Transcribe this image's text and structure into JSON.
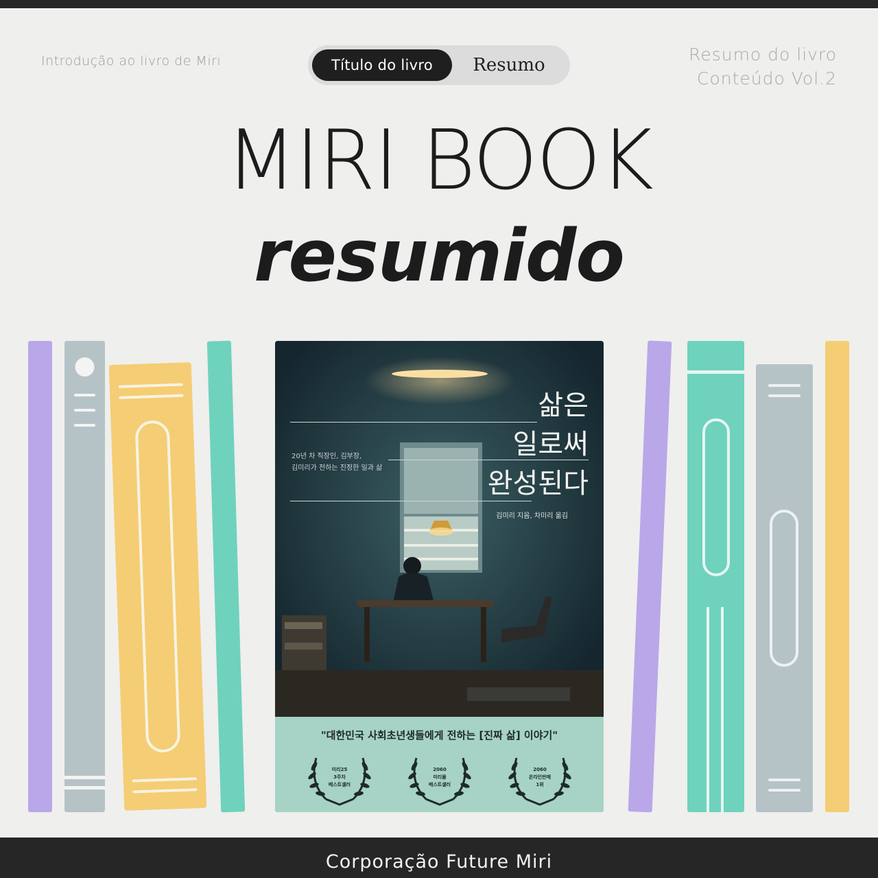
{
  "header": {
    "intro": "Introdução ao livro de Miri",
    "tabs": [
      {
        "label": "Título do livro",
        "active": true
      },
      {
        "label": "Resumo",
        "active": false
      }
    ],
    "volume_line1": "Resumo do livro",
    "volume_line2": "Conteúdo Vol.2"
  },
  "hero": {
    "title": "MIRI BOOK",
    "subtitle": "resumido"
  },
  "book": {
    "title_line1": "삶은",
    "title_line2": "일로써",
    "title_line3": "완성된다",
    "subtitle_line1": "20년 차 직장인, 김부장,",
    "subtitle_line2": "김미리가 전하는 진정한 일과 삶",
    "author": "김미리 지음, 차미리 옮김",
    "quote": "\"대한민국 사회초년생들에게 전하는 [진짜 삶] 이야기\"",
    "awards": [
      {
        "text": "미리25\n3주차\n베스트셀러"
      },
      {
        "text": "2060\n미리몰\n베스트셀러"
      },
      {
        "text": "2060\n온라인판매\n1위"
      }
    ]
  },
  "footer": {
    "company": "Corporação Future Miri"
  },
  "colors": {
    "background": "#efefed",
    "dark": "#262626",
    "purple": "#b9a7e9",
    "gray": "#b5c3c7",
    "yellow": "#f5cd74",
    "teal": "#6fd2bd",
    "band": "#a6d3c5"
  }
}
